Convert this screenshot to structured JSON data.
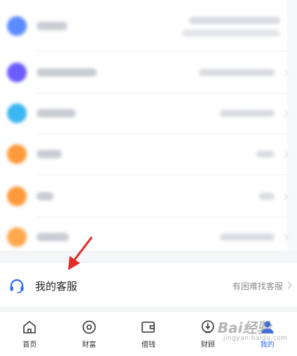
{
  "colors": {
    "accent": "#2b6bff",
    "arrow": "#e52a2a",
    "text_primary": "#222222",
    "text_secondary": "#8a8d94"
  },
  "menu_rows": [
    {
      "icon": "blurred-blue-icon",
      "color": "#5b8cff"
    },
    {
      "icon": "blurred-purple-icon",
      "color": "#6a5cff"
    },
    {
      "icon": "blurred-cyan-icon",
      "color": "#3ab6f0"
    },
    {
      "icon": "blurred-orange-icon",
      "color": "#ff9a3c"
    },
    {
      "icon": "blurred-orange-icon",
      "color": "#ff9a3c"
    },
    {
      "icon": "blurred-orange-icon",
      "color": "#ffa94d"
    }
  ],
  "customer_service": {
    "title": "我的客服",
    "hint": "有困难找客服",
    "icon": "headset-icon"
  },
  "tabbar": {
    "tabs": [
      {
        "label": "首页",
        "icon": "home-icon"
      },
      {
        "label": "财富",
        "icon": "wealth-icon"
      },
      {
        "label": "借钱",
        "icon": "wallet-icon"
      },
      {
        "label": "财顾",
        "icon": "advisor-icon"
      },
      {
        "label": "我的",
        "icon": "profile-icon",
        "active": true
      }
    ]
  },
  "watermark": {
    "main": "Bai经验",
    "sub": "jingyan.baidu.com"
  }
}
